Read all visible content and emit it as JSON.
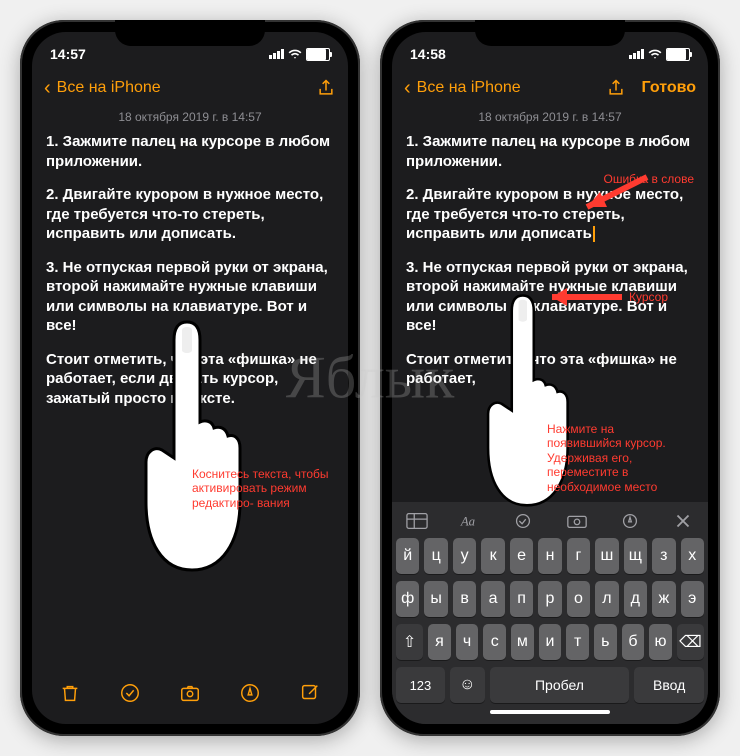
{
  "watermark": "Яблык",
  "left": {
    "time": "14:57",
    "back": "Все на iPhone",
    "timestamp": "18 октября 2019 г. в 14:57",
    "p1": "1. Зажмите палец на курсоре в любом приложении.",
    "p2": "2. Двигайте курором в нужное место, где требуется что-то стереть, исправить или дописать.",
    "p3": "3. Не отпуская первой руки от экрана, второй нажимайте нужные клавиши или символы на клавиатуре. Вот и все!",
    "p4": "Стоит отметить, что эта «фишка» не работает, если двигать курсор, зажатый просто в тексте.",
    "annotation": "Коснитесь текста, чтобы активировать режим редактиро-\nвания"
  },
  "right": {
    "time": "14:58",
    "back": "Все на iPhone",
    "done": "Готово",
    "timestamp": "18 октября 2019 г. в 14:57",
    "p1": "1. Зажмите палец на курсоре в любом приложении.",
    "p2": "2. Двигайте курором в нужное место, где требуется что-то стереть, исправить или дописать",
    "p3": "3. Не отпуская первой руки от экрана, второй нажимайте нужные клавиши или символы на клавиатуре. Вот и все!",
    "p4": "Стоит отметить, что эта «фишка» не работает,",
    "anno1": "Ошибка в слове",
    "anno2": "Курсор",
    "anno3": "Нажмите на появившийся курсор. Удерживая его, переместите в необходимое место",
    "keyboard": {
      "row1": [
        "й",
        "ц",
        "у",
        "к",
        "е",
        "н",
        "г",
        "ш",
        "щ",
        "з",
        "х"
      ],
      "row2": [
        "ф",
        "ы",
        "в",
        "а",
        "п",
        "р",
        "о",
        "л",
        "д",
        "ж",
        "э"
      ],
      "row3_shift": "⇧",
      "row3": [
        "я",
        "ч",
        "с",
        "м",
        "и",
        "т",
        "ь",
        "б",
        "ю"
      ],
      "row3_del": "⌫",
      "k123": "123",
      "emoji": "☺",
      "space": "Пробел",
      "enter": "Ввод"
    }
  }
}
